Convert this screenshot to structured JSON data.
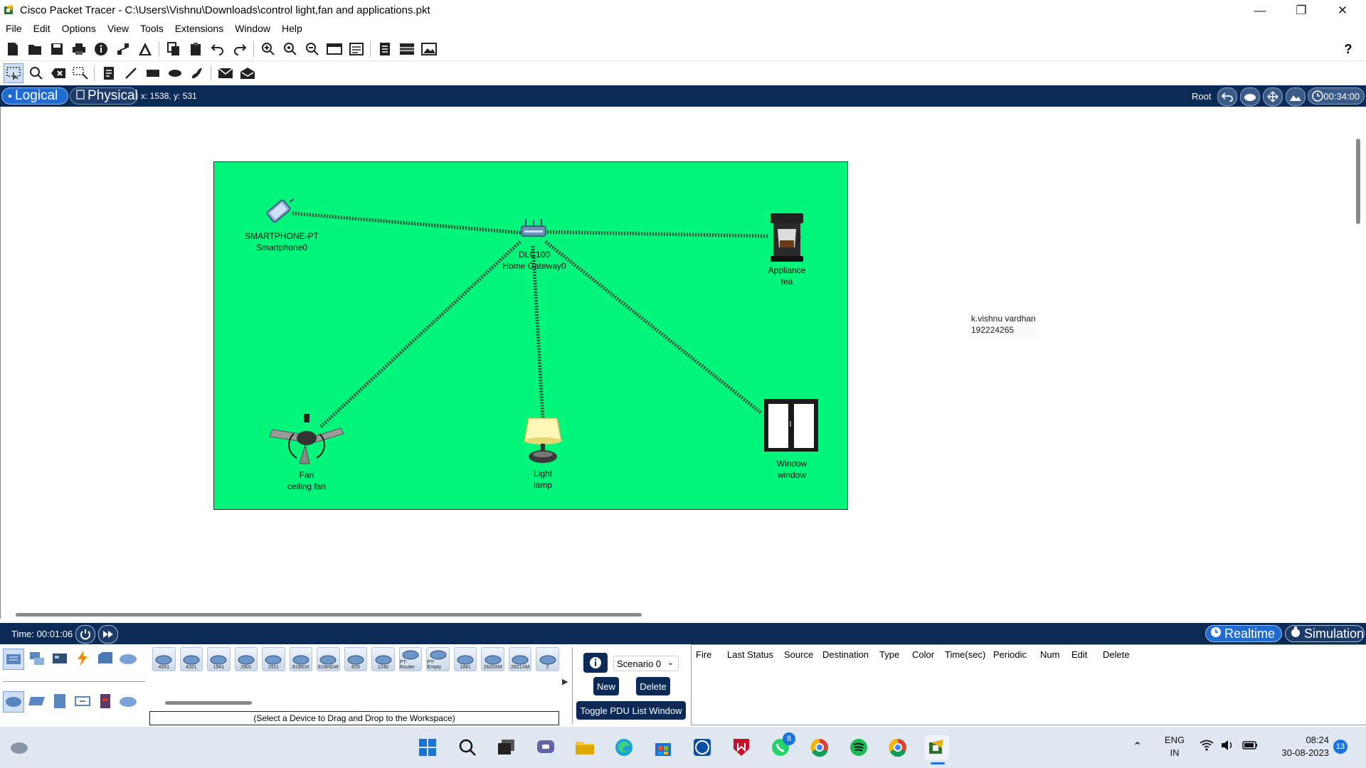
{
  "window": {
    "title": "Cisco Packet Tracer - C:\\Users\\Vishnu\\Downloads\\control light,fan and applications.pkt",
    "minimize": "—",
    "restore": "❐",
    "close": "✕"
  },
  "menu": [
    "File",
    "Edit",
    "Options",
    "View",
    "Tools",
    "Extensions",
    "Window",
    "Help"
  ],
  "toolbar": {
    "help": "?"
  },
  "nav": {
    "logical": "Logical",
    "physical": "Physical",
    "coords": "x: 1538, y: 531",
    "root": "Root",
    "clock": "00:34:00"
  },
  "devices": {
    "smartphone": {
      "model": "SMARTPHONE-PT",
      "name": "Smartphone0"
    },
    "gateway": {
      "model": "DLC100",
      "name": "Home Gateway0"
    },
    "appliance": {
      "model": "Appliance",
      "name": "tea"
    },
    "fan": {
      "model": "Fan",
      "name": "ceiling fan"
    },
    "light": {
      "model": "Light",
      "name": "lamp"
    },
    "window": {
      "model": "Window",
      "name": "window"
    }
  },
  "note": {
    "line1": "k.vishnu vardhan",
    "line2": "192224265"
  },
  "timebar": {
    "time": "Time: 00:01:06",
    "realtime": "Realtime",
    "simulation": "Simulation"
  },
  "device_models": [
    "4331",
    "4321",
    "1941",
    "2901",
    "2911",
    "819IOX",
    "819HGW",
    "829",
    "1240",
    "PT-Router",
    "PT-Empty",
    "1841",
    "2620XM",
    "2621XM",
    "2"
  ],
  "panel": {
    "hint": "(Select a Device to Drag and Drop to the Workspace)",
    "scenario": "Scenario 0",
    "new": "New",
    "delete": "Delete",
    "toggle": "Toggle PDU List Window"
  },
  "pdu_columns": [
    "Fire",
    "Last Status",
    "Source",
    "Destination",
    "Type",
    "Color",
    "Time(sec)",
    "Periodic",
    "Num",
    "Edit",
    "Delete"
  ],
  "taskbar": {
    "lang1": "ENG",
    "lang2": "IN",
    "time": "08:24",
    "date": "30-08-2023",
    "whatsapp_badge": "8",
    "notif_count": "13"
  },
  "colors": {
    "navbar": "#0b2a55",
    "cluster_bg": "#00f67a",
    "link": "#3a4a3a"
  }
}
